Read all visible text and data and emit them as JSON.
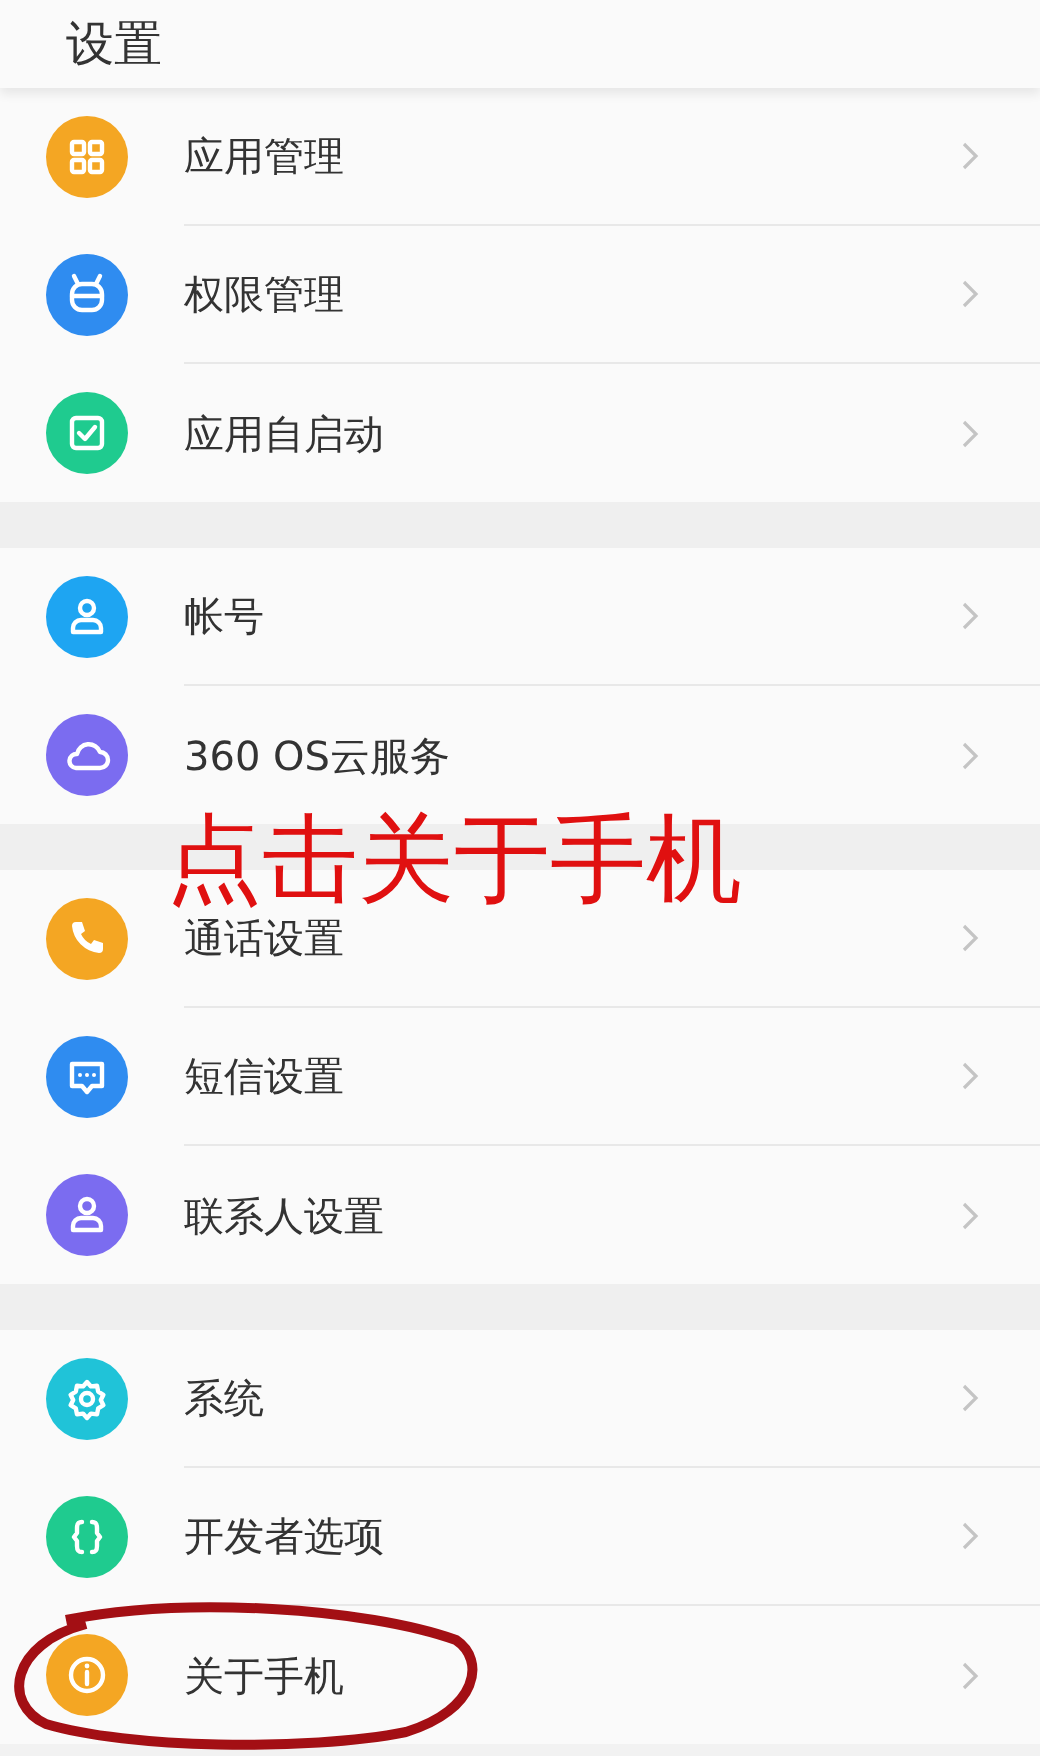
{
  "header": {
    "title": "设置"
  },
  "groups": [
    {
      "items": [
        {
          "label": "应用管理"
        },
        {
          "label": "权限管理"
        },
        {
          "label": "应用自启动"
        }
      ]
    },
    {
      "items": [
        {
          "label": "帐号"
        },
        {
          "label": "360 OS云服务"
        }
      ]
    },
    {
      "items": [
        {
          "label": "通话设置"
        },
        {
          "label": "短信设置"
        },
        {
          "label": "联系人设置"
        }
      ]
    },
    {
      "items": [
        {
          "label": "系统"
        },
        {
          "label": "开发者选项"
        },
        {
          "label": "关于手机"
        }
      ]
    }
  ],
  "annotation": {
    "text": "点击关于手机"
  }
}
